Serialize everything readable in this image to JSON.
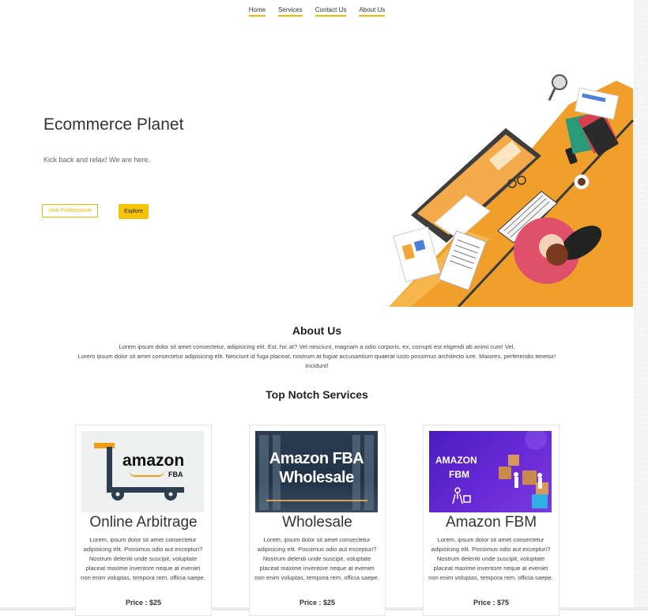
{
  "nav": {
    "items": [
      "Home",
      "Services",
      "Contact Us",
      "About Us"
    ]
  },
  "hero": {
    "title": "Ecommerce Planet",
    "subtitle": "Kick back and relax! We are here.",
    "hire_label": "Hire Professional",
    "explore_label": "Explore"
  },
  "about": {
    "title": "About Us",
    "line1": "Lorem ipsum dolor sit amet consectetur, adipisicing elit. Est, hic at? Vel nesciunt, magnam a odio corporis, ex, corrupti est eligendi ab animi cum! Vel.",
    "line2": "Lorem ipsum dolor sit amet consectetur adipisicing elit. Nesciunt id fuga placeat, nostrum at fugiat accusantium quaerat iusto possimus architecto iure. Maiores, perferendis tenetur!",
    "line3": "Incidunt!"
  },
  "services": {
    "title": "Top Notch Services",
    "cards": [
      {
        "image_text": "amazon",
        "image_sub": "FBA",
        "name": "Online Arbitrage",
        "desc": "Lorem, ipsum dolor sit amet consectetur adipisicing elit. Possimus odio aut excepturi? Nostrum deleniti unde suscipit, voluptate placeat maxime inventore neque at eveniet non enim voluptas, tempora rem, officia saepe.",
        "price": "Price : $25"
      },
      {
        "image_text": "Amazon FBA",
        "image_sub": "Wholesale",
        "name": "Wholesale",
        "desc": "Lorem, ipsum dolor sit amet consectetur adipisicing elit. Possimus odio aut excepturi? Nostrum deleniti unde suscipit, voluptate placeat maxime inventore neque at eveniet non enim voluptas, tempora rem, officia saepe.",
        "price": "Price : $25"
      },
      {
        "image_text": "AMAZON",
        "image_sub": "FBM",
        "name": "Amazon FBM",
        "desc": "Lorem, ipsum dolor sit amet consectetur adipisicing elit. Possimus odio aut excepturi? Nostrum deleniti unde suscipit, voluptate placeat maxime inventore neque at eveniet non enim voluptas, tempora rem, officia saepe.",
        "price": "Price : $75"
      }
    ]
  },
  "colors": {
    "accent": "#f2b705",
    "orange": "#f0a02a",
    "fbm_purple": "#5a21c8",
    "fba_blue": "#1f3247"
  }
}
